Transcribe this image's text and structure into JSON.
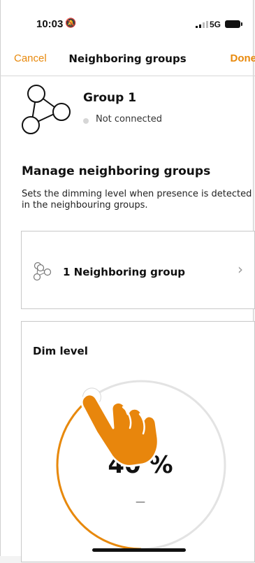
{
  "status_bar": {
    "time": "10:03",
    "network": "5G"
  },
  "nav": {
    "cancel": "Cancel",
    "title": "Neighboring groups",
    "done": "Done"
  },
  "group": {
    "name": "Group 1",
    "status": "Not connected"
  },
  "section": {
    "title": "Manage neighboring groups",
    "description": "Sets the dimming level when presence is detected in the neighbouring groups."
  },
  "neighbors": {
    "label": "1 Neighboring group"
  },
  "dim": {
    "title": "Dim level",
    "value_text": "40 %",
    "value": 40,
    "subtext": "—"
  },
  "colors": {
    "accent": "#e8890c",
    "track": "#e3e3e3"
  }
}
